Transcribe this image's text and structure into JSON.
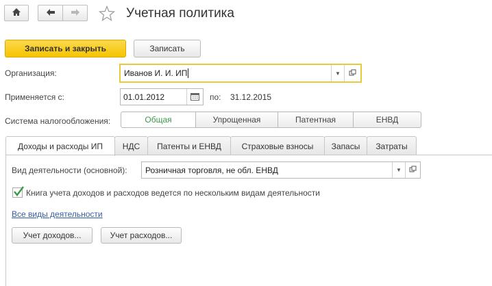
{
  "title": "Учетная политика",
  "toolbar": {
    "save_close_label": "Записать и закрыть",
    "save_label": "Записать"
  },
  "form": {
    "org_label": "Организация:",
    "org_value": "Иванов И. И. ИП",
    "applies_label": "Применяется с:",
    "date_from": "01.01.2012",
    "to_label": "по:",
    "date_to": "31.12.2015",
    "tax_label": "Система налогообложения:",
    "tax_systems": [
      "Общая",
      "Упрощенная",
      "Патентная",
      "ЕНВД"
    ],
    "tax_selected": "Общая"
  },
  "tabs": [
    "Доходы и расходы ИП",
    "НДС",
    "Патенты и ЕНВД",
    "Страховые взносы",
    "Запасы",
    "Затраты"
  ],
  "tab_panel": {
    "activity_label": "Вид деятельности (основной):",
    "activity_value": "Розничная торговля, не обл. ЕНВД",
    "checkbox_label": "Книга учета доходов и расходов ведется по нескольким видам деятельности",
    "checkbox_checked": true,
    "all_activities_link": "Все виды деятельности",
    "income_button": "Учет доходов...",
    "expense_button": "Учет расходов..."
  },
  "colors": {
    "primary": "#f5c400",
    "active_green": "#3a9a4a",
    "focus": "#e6cb3c",
    "link": "#335e9e"
  }
}
